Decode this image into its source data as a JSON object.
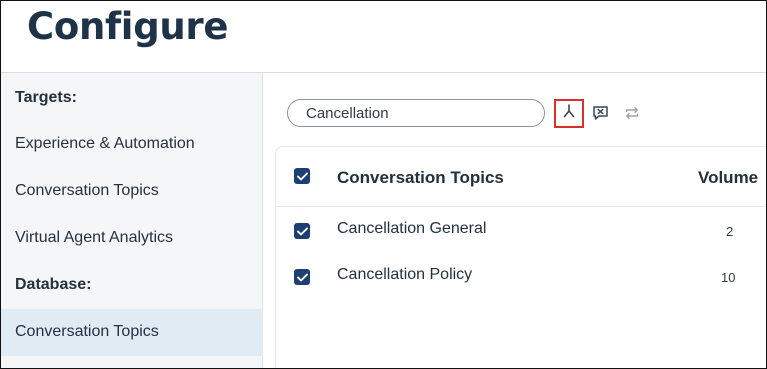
{
  "page": {
    "title": "Configure"
  },
  "sidebar": {
    "targets_heading": "Targets:",
    "targets": [
      {
        "label": "Experience & Automation"
      },
      {
        "label": "Conversation Topics"
      },
      {
        "label": "Virtual Agent Analytics"
      }
    ],
    "database_heading": "Database:",
    "database_items": [
      {
        "label": "Conversation Topics",
        "active": true
      }
    ]
  },
  "search": {
    "value": "Cancellation",
    "placeholder": ""
  },
  "toolbar": {
    "icons": [
      "merge-icon",
      "ignore-icon",
      "sync-icon"
    ]
  },
  "table": {
    "headers": {
      "topic": "Conversation Topics",
      "volume": "Volume"
    },
    "rows": [
      {
        "topic": "Cancellation General",
        "volume": "2",
        "checked": true
      },
      {
        "topic": "Cancellation Policy",
        "volume": "10",
        "checked": true
      }
    ]
  },
  "colors": {
    "title": "#1e3348",
    "checkbox": "#1e3f73",
    "active_bg": "#e1ebf4",
    "highlight_border": "#d9302a"
  }
}
